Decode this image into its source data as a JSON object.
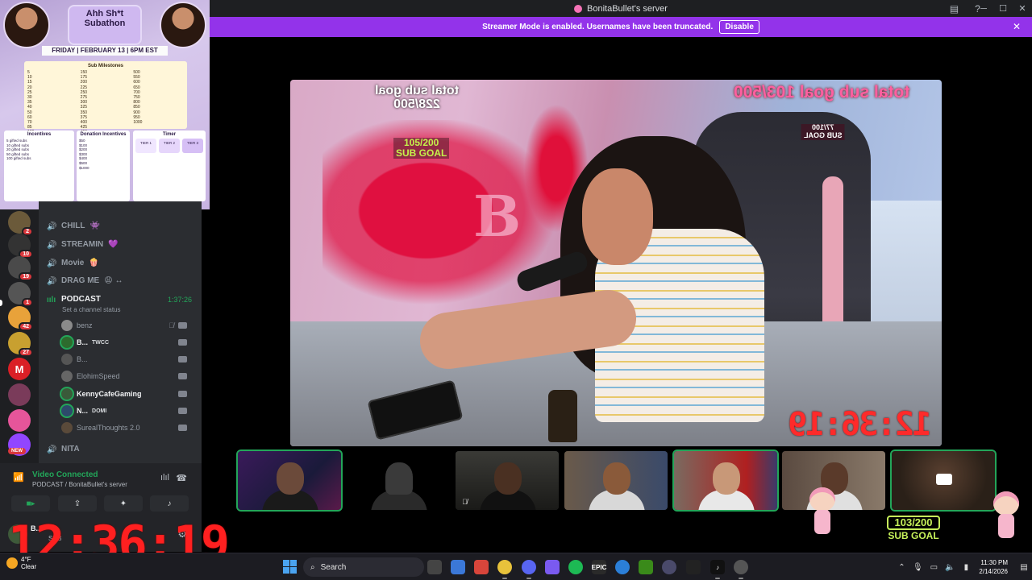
{
  "window": {
    "title": "BonitaBullet's server"
  },
  "banner": {
    "text": "Streamer Mode is enabled. Usernames have been truncated.",
    "button": "Disable"
  },
  "schedule": {
    "title_line1": "Ahh Sh*t",
    "title_line2": "Subathon",
    "date": "FRIDAY | FEBRUARY 13 | 6PM EST",
    "milestones_title": "Sub Milestones",
    "incentives_title": "Incentives",
    "donation_title": "Donation Incentives",
    "timer_title": "Timer",
    "timer_chips": [
      "TIER 1",
      "TIER 2",
      "TIER 3"
    ]
  },
  "rail": {
    "badges": [
      "2",
      "10",
      "19",
      "1",
      "42",
      "27"
    ],
    "new_label": "NEW"
  },
  "channels": [
    {
      "name": "CHILL",
      "emoji": "👾"
    },
    {
      "name": "STREAMIN",
      "emoji": "💜"
    },
    {
      "name": "Movie",
      "emoji": "🍿"
    },
    {
      "name": "DRAG ME",
      "emoji": "😩 ↔"
    }
  ],
  "podcast": {
    "name": "PODCAST",
    "time": "1:37:26",
    "status": "Set a channel status"
  },
  "voice_users": [
    {
      "name": "benz",
      "tag": "",
      "speaking": false,
      "muted": true
    },
    {
      "name": "B...",
      "tag": "TWCC",
      "speaking": true,
      "muted": false
    },
    {
      "name": "B...",
      "tag": "",
      "speaking": false,
      "muted": false
    },
    {
      "name": "ElohimSpeed",
      "tag": "",
      "speaking": false,
      "muted": false
    },
    {
      "name": "KennyCafeGaming",
      "tag": "",
      "speaking": true,
      "muted": false
    },
    {
      "name": "N...",
      "tag": "DOMI",
      "speaking": true,
      "muted": false
    },
    {
      "name": "SurealThoughts 2.0",
      "tag": "",
      "speaking": false,
      "muted": false
    }
  ],
  "nita": {
    "name": "NITA"
  },
  "voice_panel": {
    "title": "Video Connected",
    "subtitle": "PODCAST / BonitaBullet's server"
  },
  "user_panel": {
    "name": "B...",
    "status": "SUB"
  },
  "overlay": {
    "big_timer": "12:36:19",
    "stream_text_left": "total sub goal\n228/500",
    "stream_text_right": "total sub goal 103/500",
    "goal_left": "105/200\nSUB GOAL",
    "goal_right": "77/100\nSUB GOAL",
    "sub_goal_count": "103/200",
    "sub_goal_label": "SUB GOAL"
  },
  "taskbar": {
    "weather_temp": "4°F",
    "weather_cond": "Clear",
    "search_placeholder": "Search",
    "time": "11:30 PM",
    "date": "2/14/2026"
  },
  "colors": {
    "accent": "#9333ea",
    "speaking": "#23a559",
    "timer": "#ff2020",
    "goal": "#c7f25a"
  }
}
